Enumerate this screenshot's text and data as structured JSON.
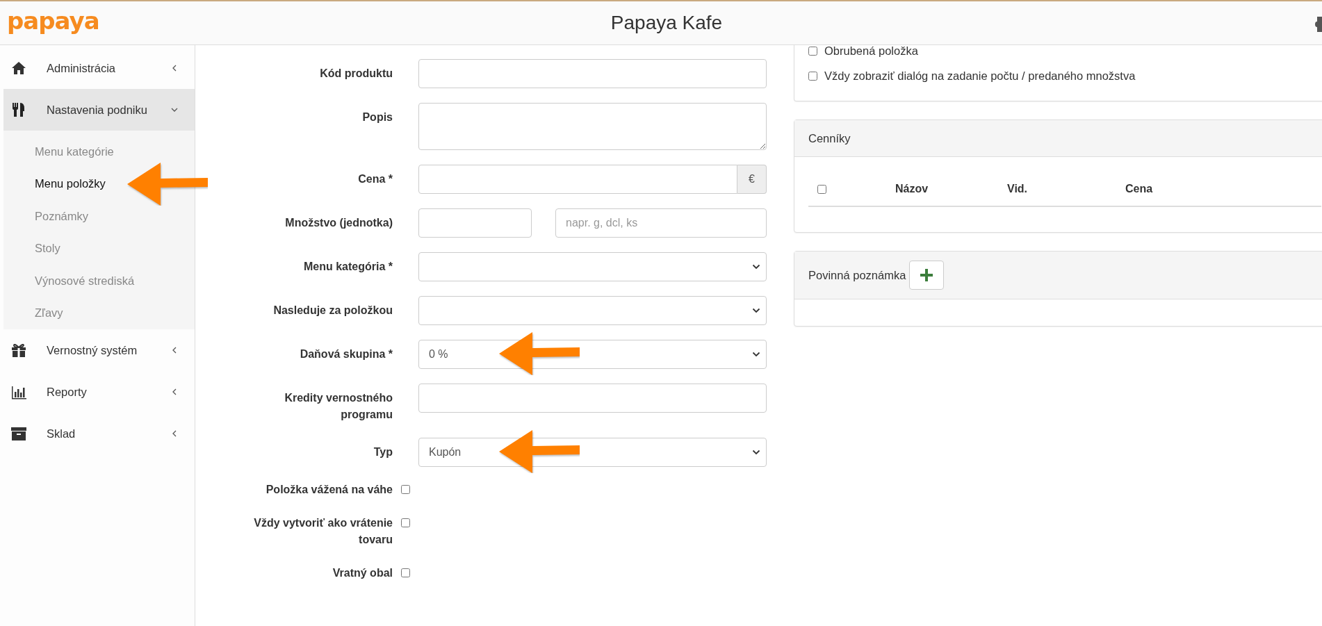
{
  "header": {
    "logo": "papaya",
    "title": "Papaya Kafe"
  },
  "sidebar": {
    "items": [
      {
        "label": "Administrácia",
        "expanded": false
      },
      {
        "label": "Nastavenia podniku",
        "expanded": true,
        "children": [
          {
            "label": "Menu kategórie",
            "selected": false
          },
          {
            "label": "Menu položky",
            "selected": true,
            "arrow": true
          },
          {
            "label": "Poznámky",
            "selected": false
          },
          {
            "label": "Stoly",
            "selected": false
          },
          {
            "label": "Výnosové strediská",
            "selected": false
          },
          {
            "label": "Zľavy",
            "selected": false
          }
        ]
      },
      {
        "label": "Vernostný systém",
        "expanded": false
      },
      {
        "label": "Reporty",
        "expanded": false
      },
      {
        "label": "Sklad",
        "expanded": false
      }
    ]
  },
  "form": {
    "fields": [
      {
        "kind": "text",
        "label": "Kód produktu"
      },
      {
        "kind": "textarea",
        "label": "Popis"
      },
      {
        "kind": "addon",
        "label": "Cena *",
        "addon": "€"
      },
      {
        "kind": "pair",
        "label": "Množstvo (jednotka)",
        "placeholder": "napr. g, dcl, ks"
      },
      {
        "kind": "select",
        "label": "Menu kategória *"
      },
      {
        "kind": "select",
        "label": "Nasleduje za položkou"
      },
      {
        "kind": "select",
        "label": "Daňová skupina *",
        "value": "0 %",
        "arrow": true
      },
      {
        "kind": "text",
        "label": "Kredity vernostného programu"
      },
      {
        "kind": "select",
        "label": "Typ",
        "value": "Kupón",
        "arrow": true
      },
      {
        "kind": "checkbox",
        "label": "Položka vážená na váhe",
        "checked": false
      },
      {
        "kind": "checkbox",
        "label": "Vždy vytvoriť ako vrátenie tovaru",
        "checked": false
      },
      {
        "kind": "checkbox",
        "label": "Vratný obal",
        "checked": false
      }
    ]
  },
  "options": [
    {
      "label": "Obrubená položka",
      "checked": false
    },
    {
      "label": "Vždy zobraziť dialóg na zadanie počtu / predaného množstva",
      "checked": false
    }
  ],
  "price_lists": {
    "title": "Cenníky",
    "select_all_checked": false,
    "columns": [
      "Názov",
      "Vid.",
      "Cena"
    ]
  },
  "mandatory_note": {
    "title": "Povinná poznámka"
  }
}
